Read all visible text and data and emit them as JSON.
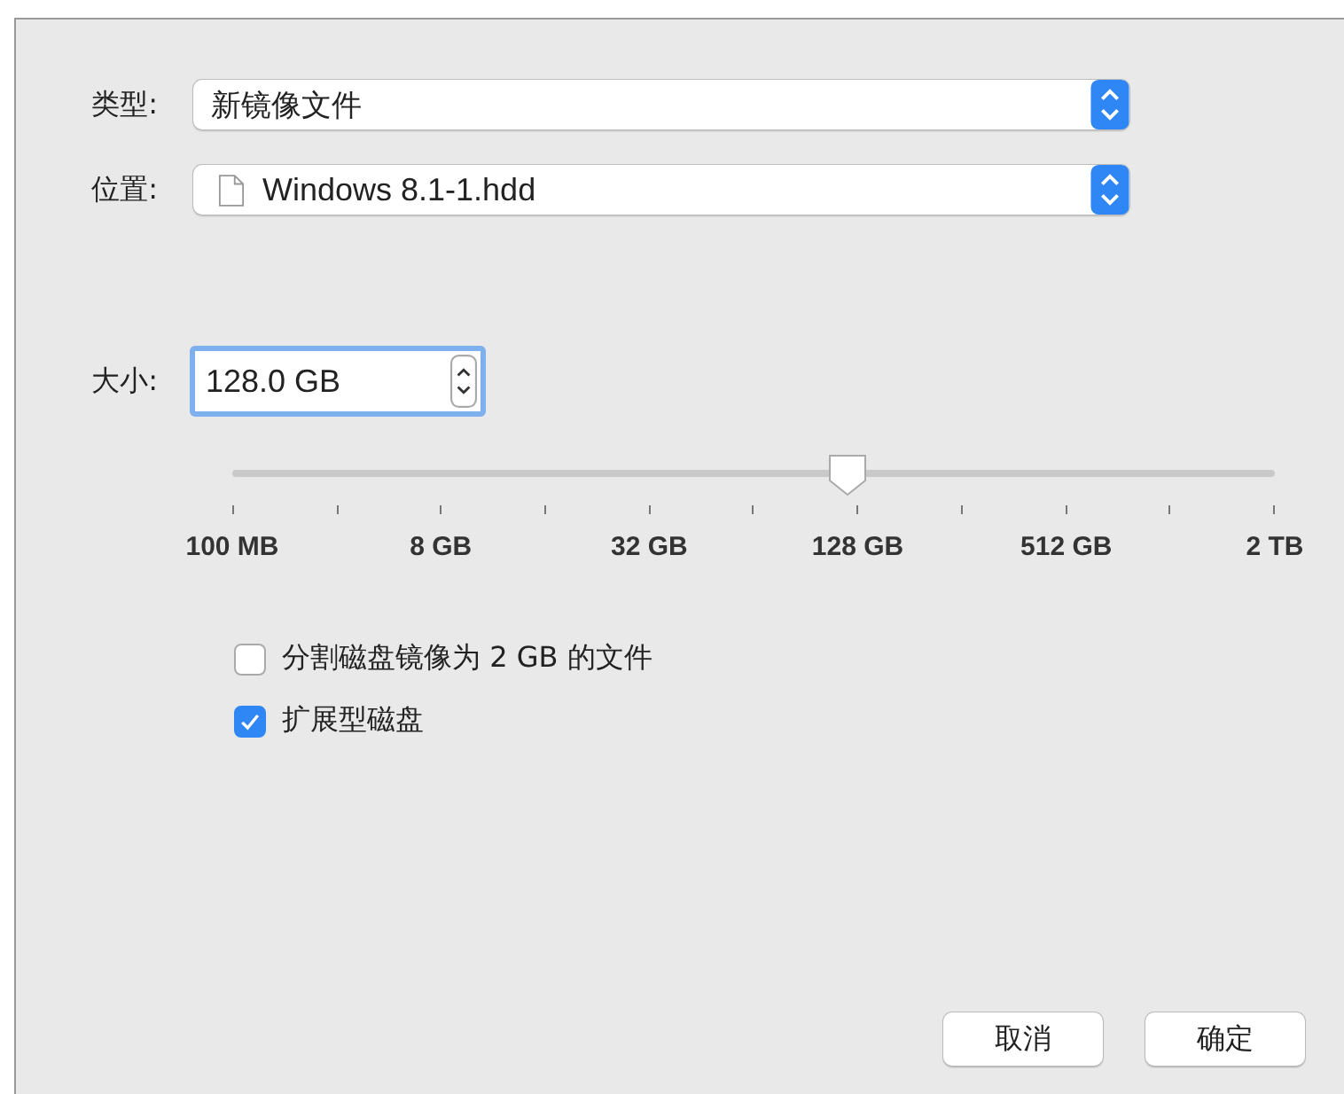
{
  "type_row": {
    "label": "类型:",
    "value": "新镜像文件"
  },
  "location_row": {
    "label": "位置:",
    "value": "Windows 8.1-1.hdd"
  },
  "size_row": {
    "label": "大小:",
    "value": "128.0 GB"
  },
  "size_slider": {
    "level": 0.59,
    "tick_labels": [
      "100 MB",
      "8 GB",
      "32 GB",
      "128 GB",
      "512 GB",
      "2 TB"
    ]
  },
  "options": [
    {
      "label": "分割磁盘镜像为 2 GB 的文件",
      "checked": false
    },
    {
      "label": "扩展型磁盘",
      "checked": true
    }
  ],
  "buttons": [
    {
      "label": "取消"
    },
    {
      "label": "确定"
    }
  ]
}
